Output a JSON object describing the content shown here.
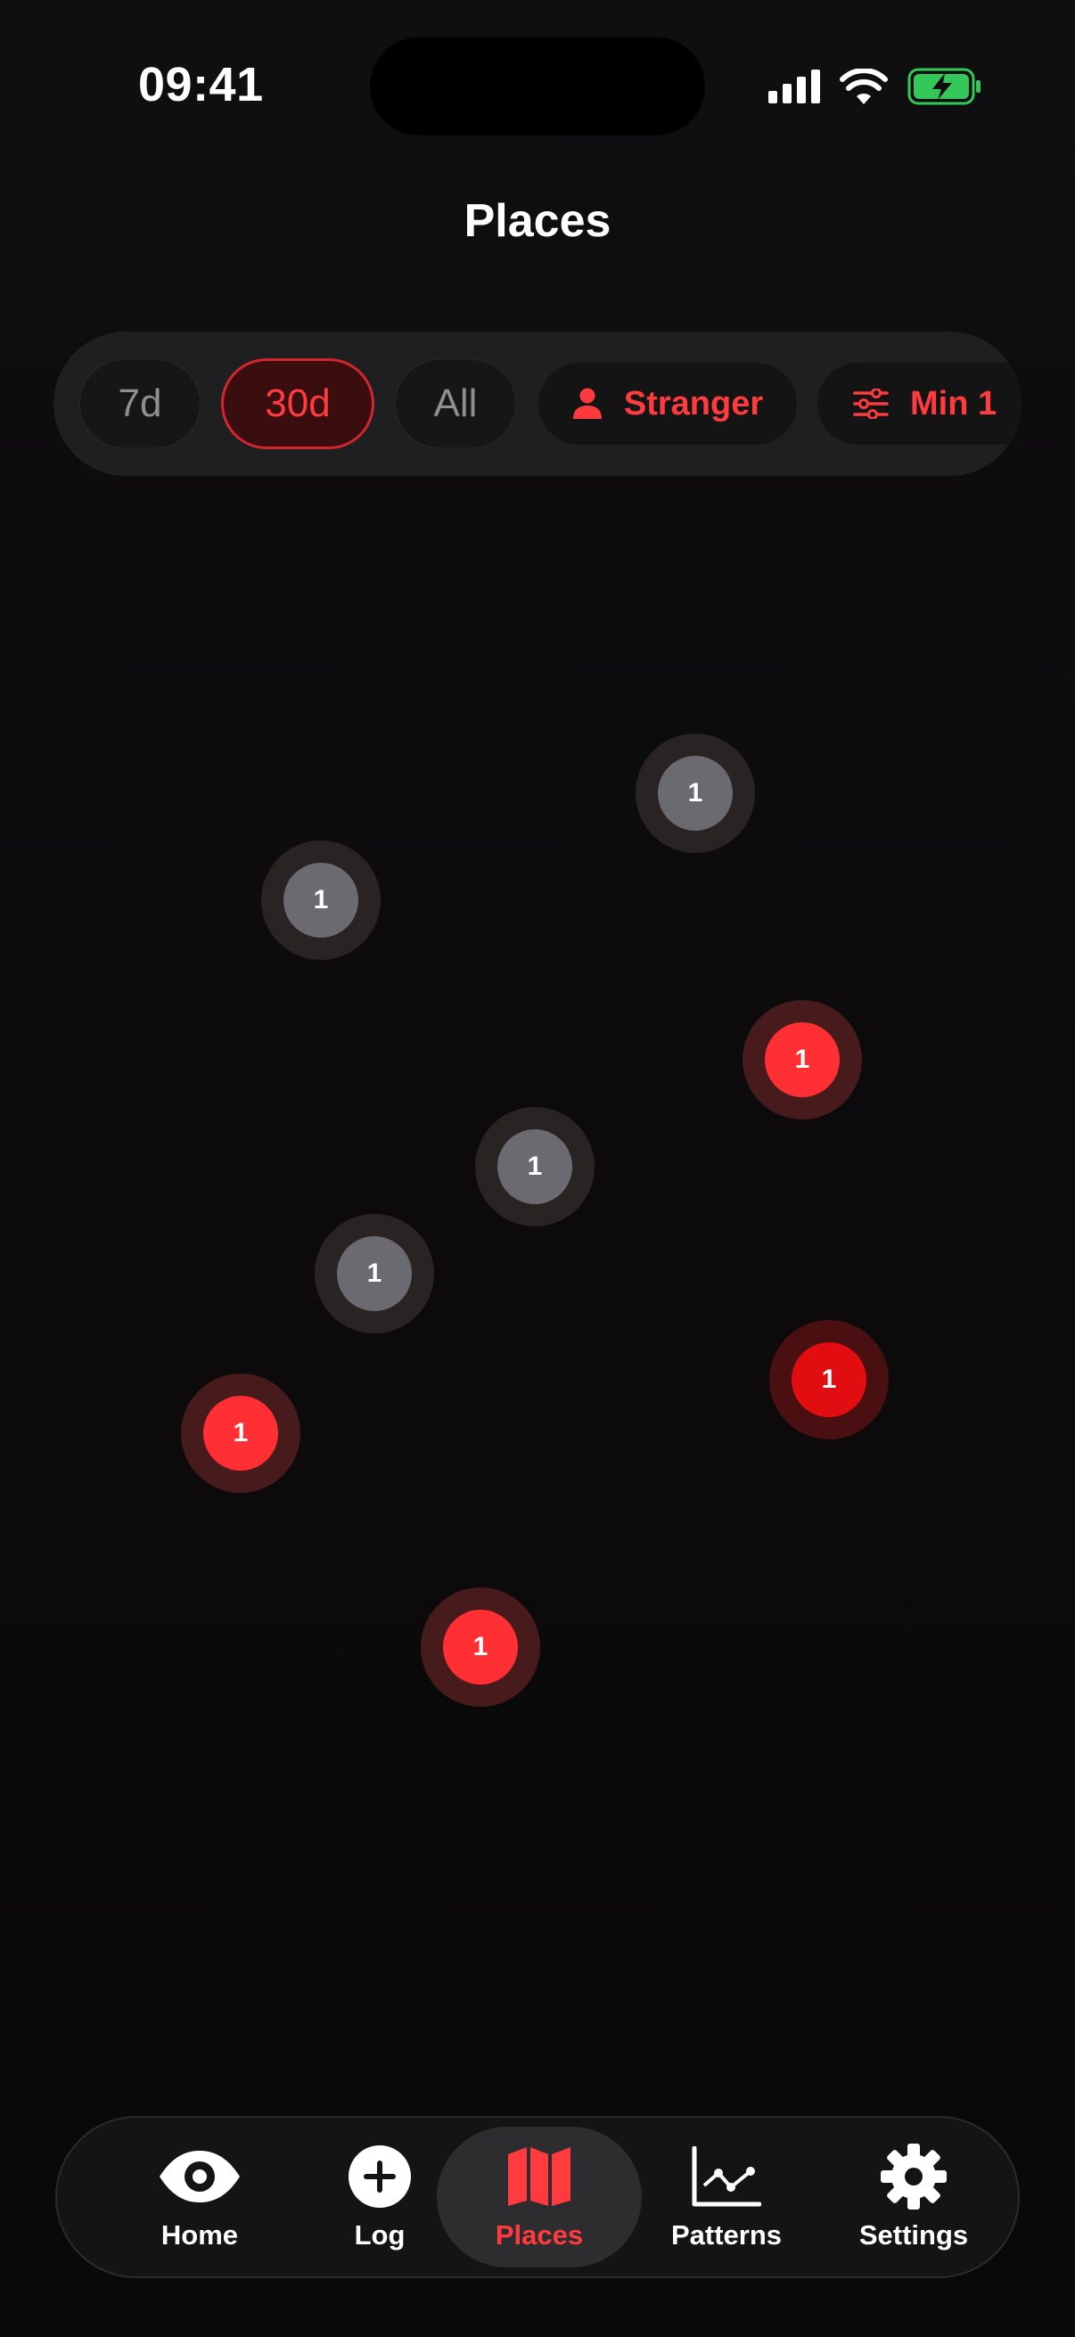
{
  "status_bar": {
    "time": "09:41"
  },
  "header": {
    "title": "Places"
  },
  "filters": {
    "period_7d": "7d",
    "period_30d": "30d",
    "period_all": "All",
    "selected_period": "30d",
    "person_filter": "Stranger",
    "min_filter": "Min 1"
  },
  "map": {
    "markers": [
      {
        "count": "1",
        "style": "grey"
      },
      {
        "count": "1",
        "style": "grey"
      },
      {
        "count": "1",
        "style": "red"
      },
      {
        "count": "1",
        "style": "grey"
      },
      {
        "count": "1",
        "style": "grey"
      },
      {
        "count": "1",
        "style": "dark-red"
      },
      {
        "count": "1",
        "style": "red"
      },
      {
        "count": "1",
        "style": "red"
      }
    ]
  },
  "tab_bar": {
    "active": "Places",
    "tabs": [
      {
        "label": "Home",
        "icon": "eye-icon"
      },
      {
        "label": "Log",
        "icon": "plus-circle-icon"
      },
      {
        "label": "Places",
        "icon": "map-icon"
      },
      {
        "label": "Patterns",
        "icon": "line-chart-icon"
      },
      {
        "label": "Settings",
        "icon": "gear-icon"
      }
    ]
  },
  "colors": {
    "accent": "#ff3b3f",
    "background": "#0e0d0f",
    "marker_grey": "#6b6a70",
    "marker_red": "#ff2f34",
    "battery_green": "#34c759"
  }
}
